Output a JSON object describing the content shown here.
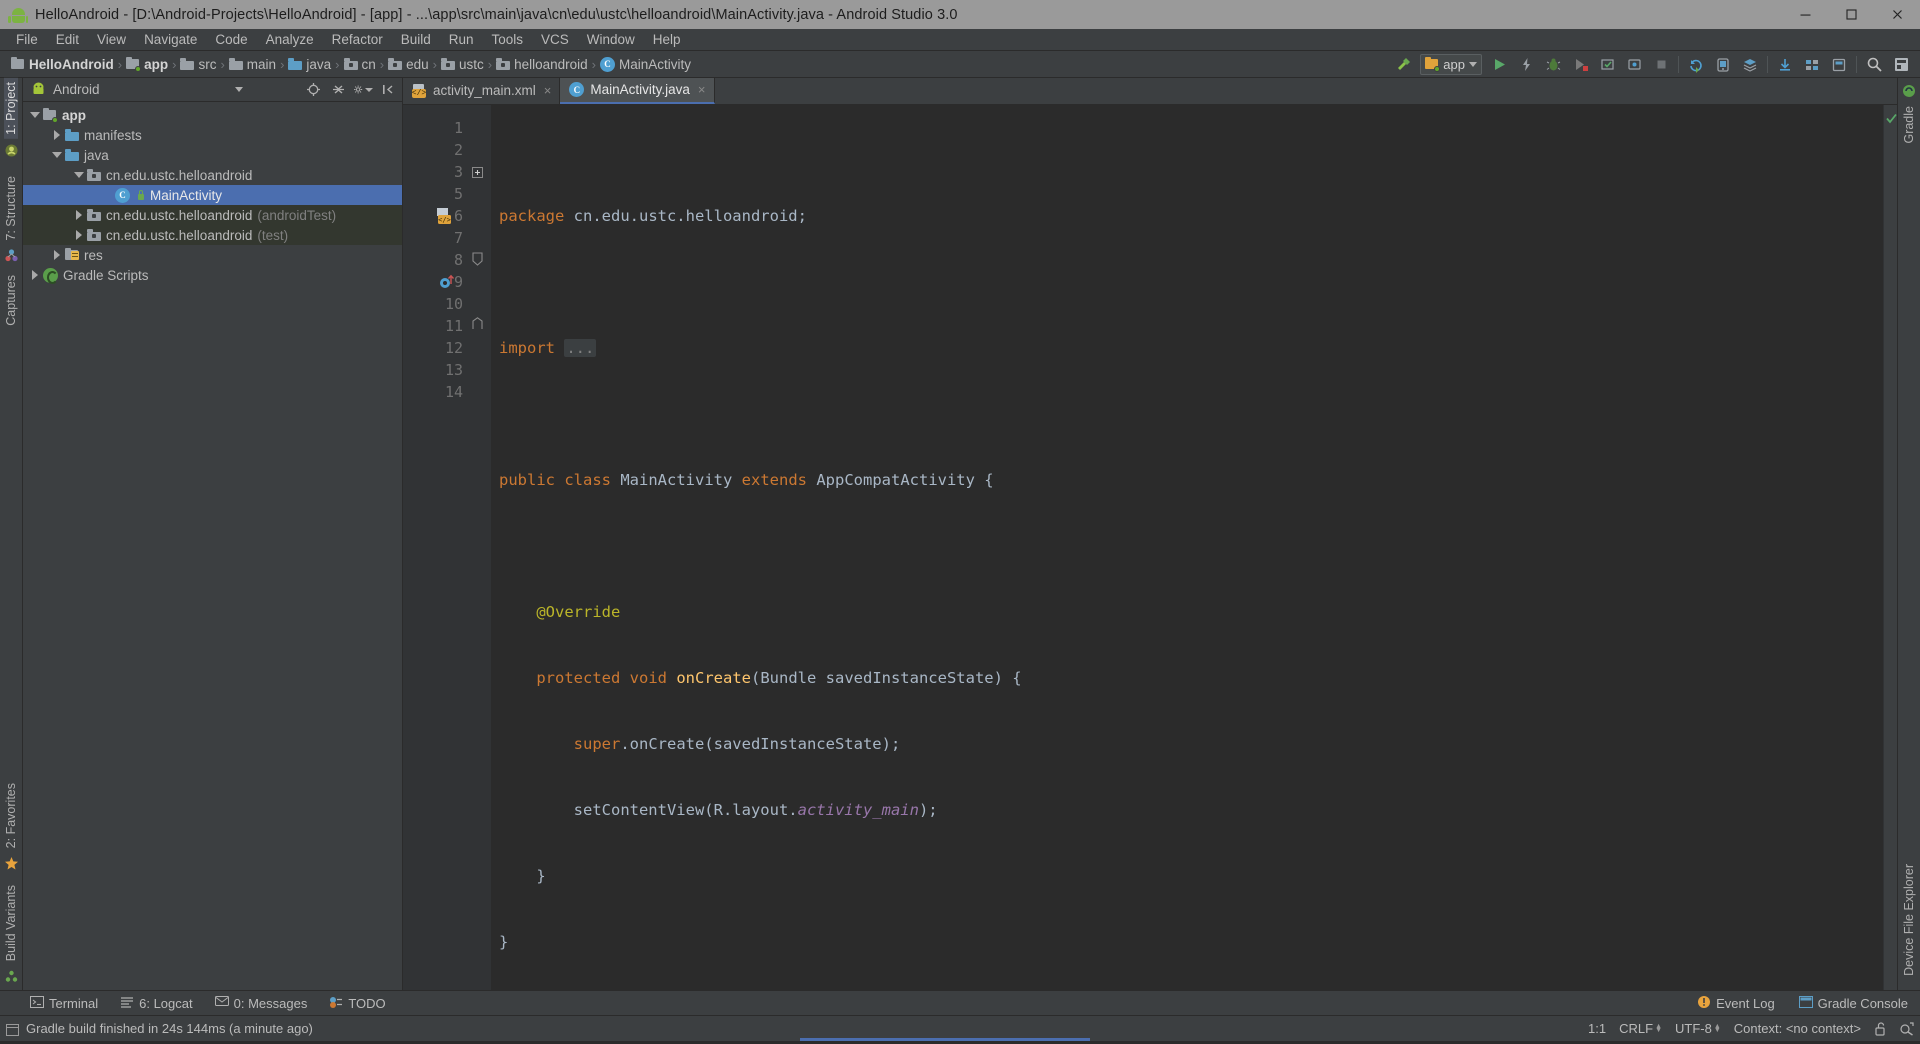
{
  "window": {
    "title": "HelloAndroid - [D:\\Android-Projects\\HelloAndroid] - [app] - ...\\app\\src\\main\\java\\cn\\edu\\ustc\\helloandroid\\MainActivity.java - Android Studio 3.0",
    "minimize_label": "Minimize",
    "maximize_label": "Maximize",
    "close_label": "Close"
  },
  "menu": {
    "items": [
      {
        "label": "File"
      },
      {
        "label": "Edit"
      },
      {
        "label": "View"
      },
      {
        "label": "Navigate"
      },
      {
        "label": "Code"
      },
      {
        "label": "Analyze"
      },
      {
        "label": "Refactor"
      },
      {
        "label": "Build"
      },
      {
        "label": "Run"
      },
      {
        "label": "Tools"
      },
      {
        "label": "VCS"
      },
      {
        "label": "Window"
      },
      {
        "label": "Help"
      }
    ]
  },
  "breadcrumb": {
    "items": [
      {
        "label": "HelloAndroid",
        "icon": "module-icon"
      },
      {
        "label": "app",
        "icon": "module-green-icon"
      },
      {
        "label": "src",
        "icon": "folder-gray-icon"
      },
      {
        "label": "main",
        "icon": "folder-gray-icon"
      },
      {
        "label": "java",
        "icon": "folder-blue-icon"
      },
      {
        "label": "cn",
        "icon": "package-icon"
      },
      {
        "label": "edu",
        "icon": "package-icon"
      },
      {
        "label": "ustc",
        "icon": "package-icon"
      },
      {
        "label": "helloandroid",
        "icon": "package-icon"
      },
      {
        "label": "MainActivity",
        "icon": "class-icon"
      }
    ],
    "separator": "›"
  },
  "toolbar": {
    "run_config": "app",
    "buttons": [
      {
        "name": "make-project-button",
        "icon": "hammer-icon"
      },
      {
        "name": "run-button",
        "icon": "play-icon"
      },
      {
        "name": "debug-button",
        "icon": "lightning-icon"
      },
      {
        "name": "debug-bug-button",
        "icon": "bug-icon"
      },
      {
        "name": "run-coverage-button",
        "icon": "coverage-icon"
      },
      {
        "name": "apply-changes-button",
        "icon": "apply-icon"
      },
      {
        "name": "attach-debugger-button",
        "icon": "attach-icon"
      },
      {
        "name": "stop-button",
        "icon": "stop-icon"
      },
      {
        "name": "avd-manager-button",
        "icon": "avd-icon"
      },
      {
        "name": "sdk-manager-button",
        "icon": "sdk-icon"
      },
      {
        "name": "sync-gradle-button",
        "icon": "sync-icon"
      },
      {
        "name": "project-structure-button",
        "icon": "structure-icon"
      },
      {
        "name": "search-everywhere-button",
        "icon": "search-icon"
      },
      {
        "name": "layout-inspector-button",
        "icon": "layout-icon"
      }
    ]
  },
  "left_strip": {
    "project_tab": "1: Project",
    "structure_tab": "7: Structure",
    "captures_tab": "Captures",
    "favorites_tab": "2: Favorites",
    "build_variants_tab": "Build Variants"
  },
  "right_strip": {
    "gradle_tab": "Gradle",
    "device_file_explorer_tab": "Device File Explorer"
  },
  "project_panel": {
    "view_selector": "Android",
    "actions": [
      {
        "name": "scroll-from-source-button",
        "icon": "target-icon"
      },
      {
        "name": "collapse-all-button",
        "icon": "collapse-icon"
      },
      {
        "name": "settings-button",
        "icon": "gear-icon"
      },
      {
        "name": "hide-button",
        "icon": "hide-icon"
      }
    ],
    "tree": [
      {
        "label": "app",
        "suffix": "",
        "indent": 0,
        "expanded": true,
        "icon": "module-green-icon",
        "bold": true,
        "selected": false,
        "test": false
      },
      {
        "label": "manifests",
        "suffix": "",
        "indent": 1,
        "expanded": false,
        "icon": "folder-blue-icon",
        "bold": false,
        "selected": false,
        "test": false
      },
      {
        "label": "java",
        "suffix": "",
        "indent": 1,
        "expanded": true,
        "icon": "folder-blue-icon",
        "bold": false,
        "selected": false,
        "test": false
      },
      {
        "label": "cn.edu.ustc.helloandroid",
        "suffix": "",
        "indent": 2,
        "expanded": true,
        "icon": "package-icon",
        "bold": false,
        "selected": false,
        "test": false
      },
      {
        "label": "MainActivity",
        "suffix": "",
        "indent": 3,
        "expanded": null,
        "icon": "class-icon",
        "bold": false,
        "selected": true,
        "test": false
      },
      {
        "label": "cn.edu.ustc.helloandroid",
        "suffix": "(androidTest)",
        "indent": 2,
        "expanded": false,
        "icon": "package-icon",
        "bold": false,
        "selected": false,
        "test": true
      },
      {
        "label": "cn.edu.ustc.helloandroid",
        "suffix": "(test)",
        "indent": 2,
        "expanded": false,
        "icon": "package-icon",
        "bold": false,
        "selected": false,
        "test": true
      },
      {
        "label": "res",
        "suffix": "",
        "indent": 1,
        "expanded": false,
        "icon": "res-icon",
        "bold": false,
        "selected": false,
        "test": false
      },
      {
        "label": "Gradle Scripts",
        "suffix": "",
        "indent": 0,
        "expanded": false,
        "icon": "gradle-icon",
        "bold": false,
        "selected": false,
        "test": false
      }
    ]
  },
  "editor": {
    "tabs": [
      {
        "label": "activity_main.xml",
        "icon": "xml-layout-icon",
        "active": false,
        "close": "×"
      },
      {
        "label": "MainActivity.java",
        "icon": "class-icon",
        "active": true,
        "close": "×"
      }
    ],
    "line_numbers": [
      "1",
      "2",
      "3",
      "5",
      "6",
      "7",
      "8",
      "9",
      "10",
      "11",
      "12",
      "13",
      "14"
    ],
    "lines": [
      {
        "n": "1",
        "tokens": [
          {
            "t": "package",
            "c": "kw"
          },
          {
            "t": " cn.edu.ustc.helloandroid;",
            "c": "id"
          }
        ]
      },
      {
        "n": "2",
        "tokens": []
      },
      {
        "n": "3",
        "tokens": [
          {
            "t": "import",
            "c": "kw"
          },
          {
            "t": " ",
            "c": "id"
          },
          {
            "t": "...",
            "c": "fldbox"
          }
        ]
      },
      {
        "n": "5",
        "tokens": []
      },
      {
        "n": "6",
        "tokens": [
          {
            "t": "public",
            "c": "kw"
          },
          {
            "t": " ",
            "c": "id"
          },
          {
            "t": "class",
            "c": "kw"
          },
          {
            "t": " MainActivity ",
            "c": "id"
          },
          {
            "t": "extends",
            "c": "kw"
          },
          {
            "t": " AppCompatActivity {",
            "c": "id"
          }
        ]
      },
      {
        "n": "7",
        "tokens": []
      },
      {
        "n": "8",
        "tokens": [
          {
            "t": "    @Override",
            "c": "ann"
          }
        ]
      },
      {
        "n": "9",
        "tokens": [
          {
            "t": "    ",
            "c": "id"
          },
          {
            "t": "protected",
            "c": "kw"
          },
          {
            "t": " ",
            "c": "id"
          },
          {
            "t": "void",
            "c": "kw"
          },
          {
            "t": " ",
            "c": "id"
          },
          {
            "t": "onCreate",
            "c": "mth"
          },
          {
            "t": "(Bundle savedInstanceState) {",
            "c": "id"
          }
        ]
      },
      {
        "n": "10",
        "tokens": [
          {
            "t": "        ",
            "c": "id"
          },
          {
            "t": "super",
            "c": "kw"
          },
          {
            "t": ".onCreate(savedInstanceState);",
            "c": "id"
          }
        ]
      },
      {
        "n": "11",
        "tokens": [
          {
            "t": "        setContentView(R.layout.",
            "c": "id"
          },
          {
            "t": "activity_main",
            "c": "fld"
          },
          {
            "t": ");",
            "c": "id"
          }
        ]
      },
      {
        "n": "12",
        "tokens": [
          {
            "t": "    }",
            "c": "id"
          }
        ]
      },
      {
        "n": "13",
        "tokens": [
          {
            "t": "}",
            "c": "id"
          }
        ]
      },
      {
        "n": "14",
        "tokens": []
      }
    ],
    "gutter_markers": [
      {
        "line": "6",
        "icon": "class-marker-icon"
      },
      {
        "line": "9",
        "icon": "override-method-icon"
      }
    ],
    "inspection_status": "ok"
  },
  "bottom_bar": {
    "items": [
      {
        "label": "Terminal",
        "icon": "terminal-icon"
      },
      {
        "label": "6: Logcat",
        "icon": "logcat-icon"
      },
      {
        "label": "0: Messages",
        "icon": "messages-icon"
      },
      {
        "label": "TODO",
        "icon": "todo-icon"
      }
    ],
    "right_items": [
      {
        "label": "Event Log",
        "icon": "event-log-icon"
      },
      {
        "label": "Gradle Console",
        "icon": "gradle-console-icon"
      }
    ]
  },
  "status_bar": {
    "message": "Gradle build finished in 24s 144ms (a minute ago)",
    "caret_position": "1:1",
    "line_separator": "CRLF",
    "encoding": "UTF-8",
    "context": "Context: <no context>",
    "lock_icon": "unlocked-icon",
    "inspection_icon": "inspections-icon"
  },
  "colors": {
    "accent": "#4b6eaf",
    "panel_bg": "#3c3f41",
    "editor_bg": "#2b2b2b",
    "gutter_bg": "#313335",
    "keyword": "#cc7832",
    "method": "#ffc66d",
    "annotation": "#bbb529",
    "field": "#9876aa",
    "text": "#a9b7c6",
    "green": "#62a62a"
  }
}
